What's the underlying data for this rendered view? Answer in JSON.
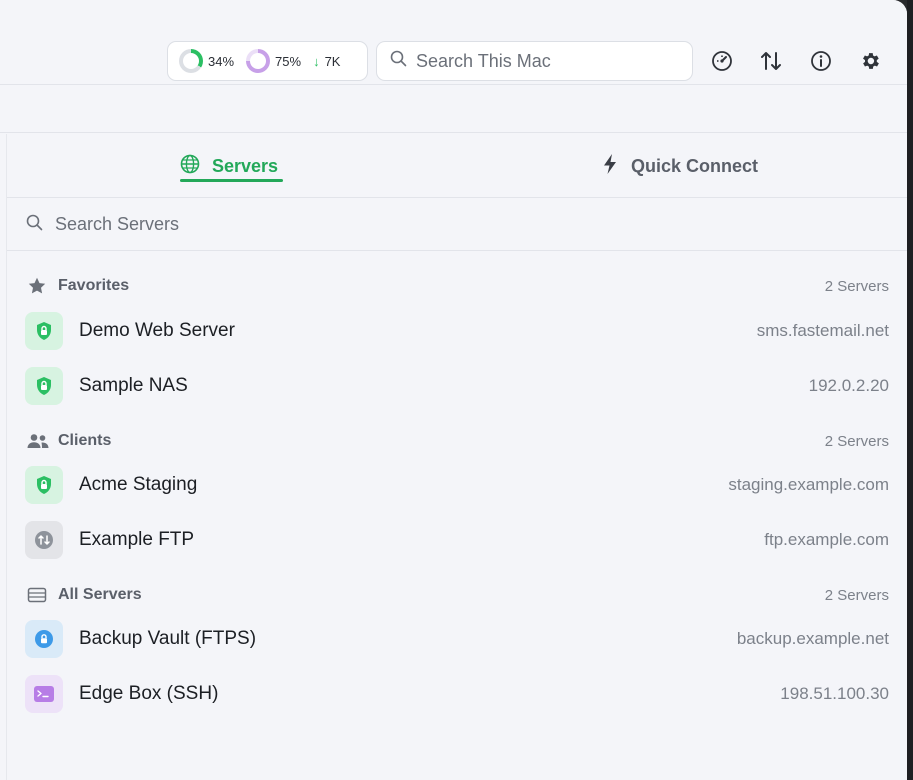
{
  "toolbar": {
    "cpu_percent": "34%",
    "cpu_value": 0.34,
    "mem_percent": "75%",
    "mem_value": 0.75,
    "net_arrow": "↓",
    "net_value": "7K",
    "search_placeholder": "Search This Mac",
    "icons": [
      "speedometer-icon",
      "transfer-arrows-icon",
      "info-icon",
      "gear-icon"
    ]
  },
  "tabs": [
    {
      "label": "Servers",
      "icon": "globe-icon",
      "active": true
    },
    {
      "label": "Quick Connect",
      "icon": "lightning-icon",
      "active": false
    }
  ],
  "search_servers": {
    "placeholder": "Search Servers"
  },
  "sections": [
    {
      "title": "Favorites",
      "icon": "star-icon",
      "count": "2 Servers",
      "servers": [
        {
          "name": "Demo Web Server",
          "host": "sms.fastemail.net",
          "icon": "shield-lock-icon"
        },
        {
          "name": "Sample NAS",
          "host": "192.0.2.20",
          "icon": "shield-lock-icon"
        }
      ]
    },
    {
      "title": "Clients",
      "icon": "people-icon",
      "count": "2 Servers",
      "servers": [
        {
          "name": "Acme Staging",
          "host": "staging.example.com",
          "icon": "shield-lock-icon"
        },
        {
          "name": "Example FTP",
          "host": "ftp.example.com",
          "icon": "transfer-circle-icon"
        }
      ]
    },
    {
      "title": "All Servers",
      "icon": "server-rack-icon",
      "count": "2 Servers",
      "servers": [
        {
          "name": "Backup Vault (FTPS)",
          "host": "backup.example.net",
          "icon": "lock-circle-icon"
        },
        {
          "name": "Edge Box (SSH)",
          "host": "198.51.100.30",
          "icon": "terminal-icon"
        }
      ]
    }
  ],
  "colors": {
    "accent": "#23a859",
    "background": "#f4f5f9",
    "text": "#1c1f24",
    "muted": "#7c818a"
  }
}
